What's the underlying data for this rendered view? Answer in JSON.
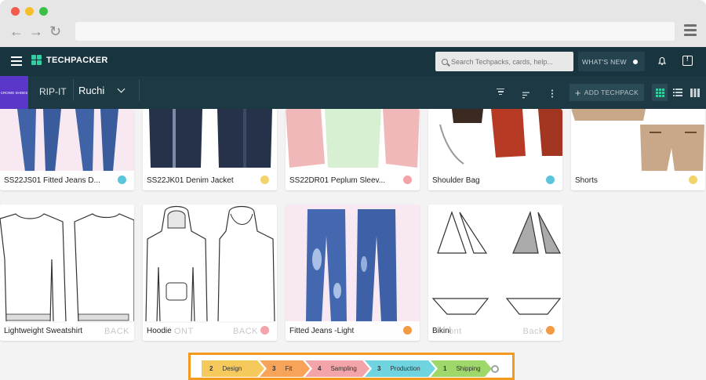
{
  "colors": {
    "topbar": "#18343f",
    "subbar": "#1d3a44",
    "brand_tile": "#5a37c8",
    "accent_green": "#2fcfa0",
    "stage_frame": "#f39a1e",
    "traffic_red": "#f35a4c",
    "traffic_yellow": "#f5bf2c",
    "traffic_green": "#3dbf47"
  },
  "app": {
    "logo_text": "TECHPACKER",
    "search_placeholder": "Search Techpacks, cards, help...",
    "whats_new_label": "WHAT'S NEW"
  },
  "subbar": {
    "brand_name": "CROWD SHOES",
    "company": "RIP-IT",
    "user": "Ruchi",
    "add_button_label": "ADD TECHPACK"
  },
  "cards": [
    {
      "title": "SS22JS01 Fitted Jeans D...",
      "dot_color": "#5bc6d9",
      "icon": "jeans-icon"
    },
    {
      "title": "SS22JK01 Denim Jacket",
      "dot_color": "#f3d36b",
      "icon": "jacket-icon"
    },
    {
      "title": "SS22DR01 Peplum Sleev...",
      "dot_color": "#f3a4a8",
      "icon": "dress-icon"
    },
    {
      "title": "Shoulder Bag",
      "dot_color": "#5bc6d9",
      "icon": "bag-icon"
    },
    {
      "title": "Shorts",
      "dot_color": "#f3d36b",
      "icon": "shorts-icon"
    },
    {
      "title": "Lightweight Sweatshirt",
      "dot_color": "",
      "icon": "sweatshirt-icon",
      "ghost_right": "BACK"
    },
    {
      "title": "Hoodie",
      "dot_color": "#f3a4a8",
      "icon": "hoodie-icon",
      "ghost_left": "ONT",
      "ghost_right": "BACK"
    },
    {
      "title": "Fitted Jeans -Light",
      "dot_color": "#f39a44",
      "icon": "jeans-icon"
    },
    {
      "title": "Bikini",
      "dot_color": "#f39a44",
      "icon": "bikini-icon",
      "ghost_left": "ont",
      "ghost_right": "Back"
    }
  ],
  "stages": [
    {
      "count": "2",
      "label": "Design",
      "color": "#f6c95c"
    },
    {
      "count": "3",
      "label": "Fit",
      "color": "#f7a35a"
    },
    {
      "count": "4",
      "label": "Sampling",
      "color": "#f3a4a8"
    },
    {
      "count": "3",
      "label": "Production",
      "color": "#6fd4e0"
    },
    {
      "count": "1",
      "label": "Shipping",
      "color": "#9fd86a"
    }
  ]
}
